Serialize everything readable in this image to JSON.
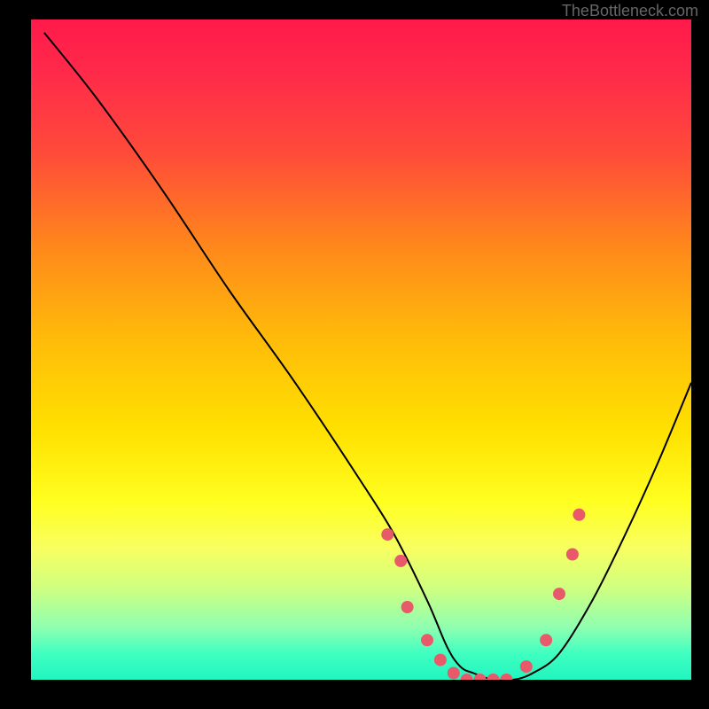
{
  "watermark": "TheBottleneck.com",
  "chart_data": {
    "type": "line",
    "title": "",
    "xlabel": "",
    "ylabel": "",
    "xlim": [
      0,
      100
    ],
    "ylim": [
      0,
      100
    ],
    "grid": false,
    "legend": false,
    "background": "rainbow-gradient-vertical",
    "series": [
      {
        "name": "curve",
        "x": [
          2,
          10,
          20,
          30,
          40,
          50,
          55,
          60,
          63,
          65,
          67,
          70,
          73,
          76,
          80,
          85,
          90,
          95,
          100
        ],
        "y": [
          98,
          88,
          74,
          59,
          45,
          30,
          22,
          12,
          5,
          2,
          1,
          0,
          0,
          1,
          4,
          12,
          22,
          33,
          45
        ]
      }
    ],
    "scatter_points": {
      "name": "markers",
      "x": [
        54,
        56,
        57,
        60,
        62,
        64,
        66,
        68,
        70,
        72,
        75,
        78,
        80,
        82,
        83
      ],
      "y": [
        22,
        18,
        11,
        6,
        3,
        1,
        0,
        0,
        0,
        0,
        2,
        6,
        13,
        19,
        25
      ]
    }
  }
}
